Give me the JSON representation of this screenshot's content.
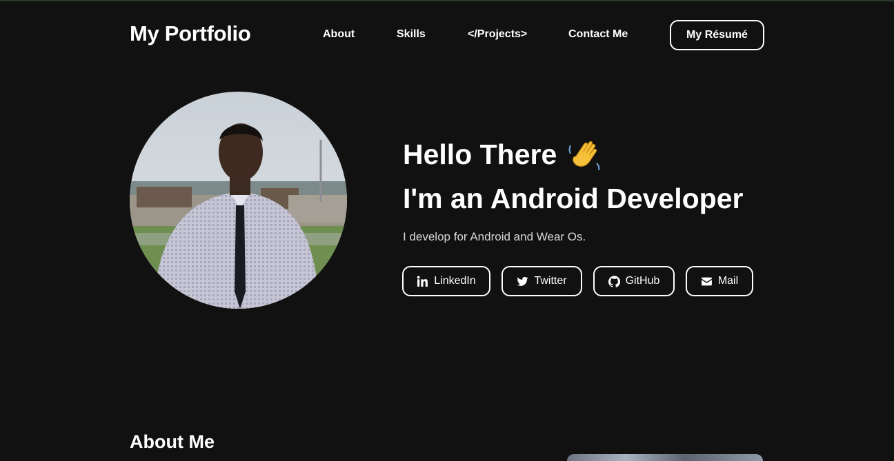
{
  "header": {
    "brand": "My Portfolio",
    "nav": [
      "About",
      "Skills",
      "</Projects>",
      "Contact Me"
    ],
    "resume_label": "My Résumé"
  },
  "hero": {
    "greeting": "Hello There",
    "greeting_emoji": "waving-hand-icon",
    "role": "I'm an Android Developer",
    "tagline": "I develop for Android and Wear Os.",
    "socials": [
      {
        "label": "LinkedIn",
        "icon": "linkedin-icon"
      },
      {
        "label": "Twitter",
        "icon": "twitter-icon"
      },
      {
        "label": "GitHub",
        "icon": "github-icon"
      },
      {
        "label": "Mail",
        "icon": "mail-icon"
      }
    ]
  },
  "about": {
    "heading": "About Me"
  },
  "colors": {
    "background": "#111111",
    "text": "#ffffff",
    "muted_text": "#d8d8d8"
  }
}
